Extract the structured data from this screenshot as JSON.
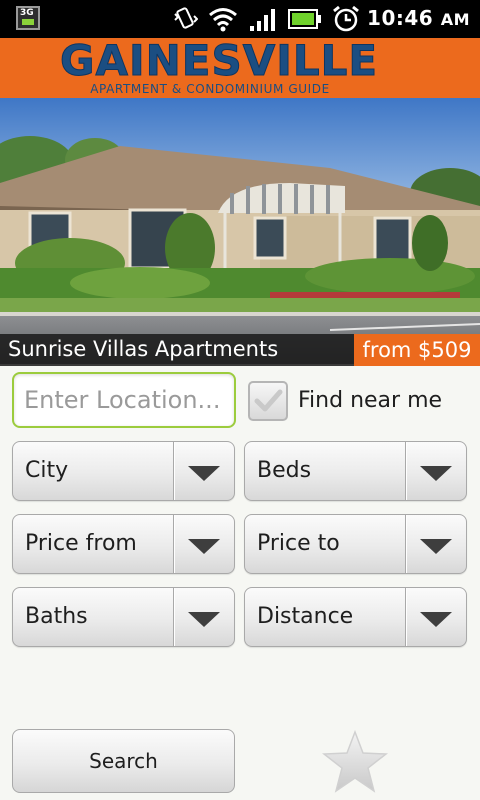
{
  "status_bar": {
    "network": "3G",
    "time": "10:46",
    "ampm": "AM"
  },
  "header": {
    "title": "GAINESVILLE",
    "subtitle": "APARTMENT & CONDOMINIUM GUIDE"
  },
  "featured": {
    "name": "Sunrise Villas Apartments",
    "price": "from $509"
  },
  "location": {
    "placeholder": "Enter Location...",
    "find_near_me_label": "Find near me",
    "find_near_me_checked": false
  },
  "filters": {
    "city": "City",
    "beds": "Beds",
    "price_from": "Price from",
    "price_to": "Price to",
    "baths": "Baths",
    "distance": "Distance"
  },
  "search_button": "Search",
  "colors": {
    "accent_orange": "#ec6a1d",
    "brand_blue": "#1b4e82",
    "focus_green": "#9ccc3d"
  }
}
